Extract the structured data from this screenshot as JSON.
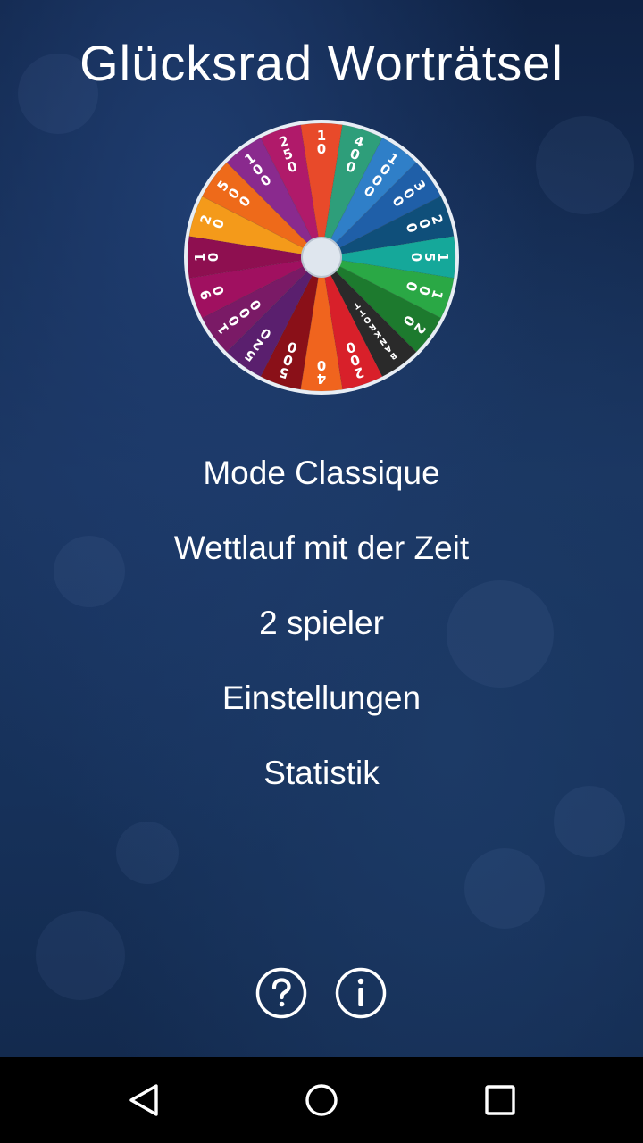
{
  "app": {
    "title": "Glücksrad Worträtsel"
  },
  "wheel": {
    "segments": [
      {
        "label": "10",
        "color": "#e84a2a"
      },
      {
        "label": "400",
        "color": "#2e9e7a"
      },
      {
        "label": "1000",
        "color": "#2f7fc8"
      },
      {
        "label": "300",
        "color": "#1f5fa8"
      },
      {
        "label": "200",
        "color": "#0f4f7a"
      },
      {
        "label": "150",
        "color": "#15a89a"
      },
      {
        "label": "100",
        "color": "#2aa845"
      },
      {
        "label": "20",
        "color": "#1d7a2e"
      },
      {
        "label": "BANKROTT",
        "color": "#2a2a2a"
      },
      {
        "label": "200",
        "color": "#d8202a"
      },
      {
        "label": "40",
        "color": "#f0641e"
      },
      {
        "label": "500",
        "color": "#8a1018"
      },
      {
        "label": "520",
        "color": "#5a1f6e"
      },
      {
        "label": "1000",
        "color": "#7a1a66"
      },
      {
        "label": "90",
        "color": "#a01060"
      },
      {
        "label": "10",
        "color": "#8e0f50"
      },
      {
        "label": "20",
        "color": "#f49a1a"
      },
      {
        "label": "500",
        "color": "#ee6a1a"
      },
      {
        "label": "100",
        "color": "#8a2a8e"
      },
      {
        "label": "250",
        "color": "#b01a6a"
      }
    ]
  },
  "menu": {
    "items": [
      {
        "id": "classic",
        "label": "Mode Classique"
      },
      {
        "id": "time",
        "label": "Wettlauf mit der Zeit"
      },
      {
        "id": "two-player",
        "label": "2 spieler"
      },
      {
        "id": "settings",
        "label": "Einstellungen"
      },
      {
        "id": "stats",
        "label": "Statistik"
      }
    ]
  },
  "footer": {
    "help_icon": "question-circle-icon",
    "info_icon": "info-circle-icon"
  },
  "navbar": {
    "back_icon": "back-triangle-icon",
    "home_icon": "home-circle-icon",
    "recents_icon": "recents-square-icon"
  }
}
